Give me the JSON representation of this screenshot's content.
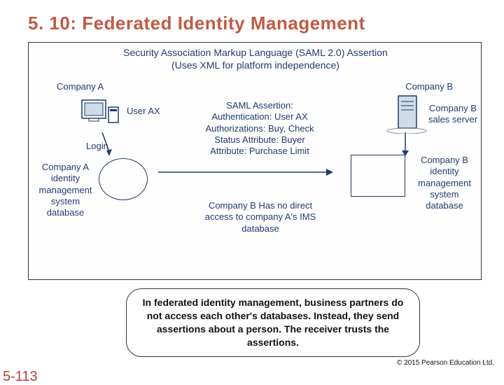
{
  "title": "5. 10: Federated Identity Management",
  "diagram": {
    "header_line1": "Security Association Markup Language (SAML 2.0) Assertion",
    "header_line2": "(Uses XML for platform independence)",
    "company_a": "Company A",
    "company_b": "Company B",
    "user_ax": "User AX",
    "login": "Login",
    "company_a_db": "Company A identity management system database",
    "saml_assertion": "SAML Assertion: Authentication: User AX Authorizations: Buy, Check Status Attribute: Buyer Attribute: Purchase Limit",
    "company_b_note": "Company B Has no direct access to company A's IMS database",
    "company_b_server": "Company B sales server",
    "company_b_db": "Company B identity management system database"
  },
  "caption": "In federated identity management, business partners do not access each other's databases. Instead, they send assertions about a person. The receiver trusts the assertions.",
  "page_number": "5-113",
  "copyright": "© 2015 Pearson Education Ltd."
}
